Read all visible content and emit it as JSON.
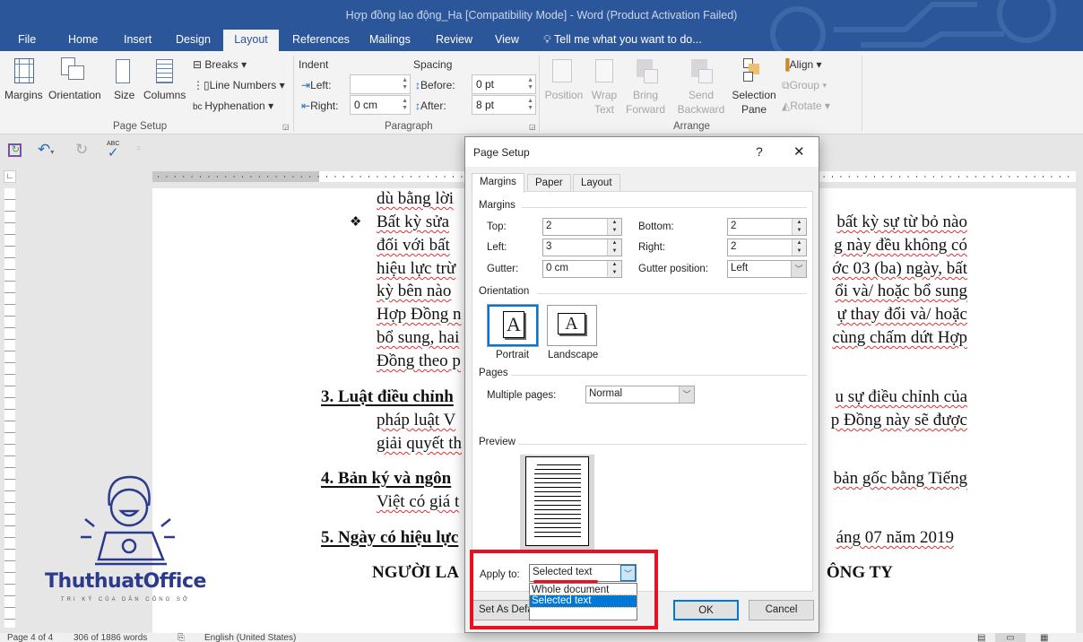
{
  "window": {
    "title": "Hợp đồng lao động_Ha [Compatibility Mode] - Word (Product Activation Failed)"
  },
  "tabs": [
    "File",
    "Home",
    "Insert",
    "Design",
    "Layout",
    "References",
    "Mailings",
    "Review",
    "View"
  ],
  "active_tab": "Layout",
  "tell_me": "Tell me what you want to do...",
  "ribbon": {
    "page_setup": {
      "label": "Page Setup",
      "margins": "Margins",
      "orientation": "Orientation",
      "size": "Size",
      "columns": "Columns",
      "breaks": "Breaks",
      "line_numbers": "Line Numbers",
      "hyphenation": "Hyphenation"
    },
    "paragraph": {
      "label": "Paragraph",
      "indent": "Indent",
      "spacing": "Spacing",
      "left": "Left:",
      "left_value": "",
      "right": "Right:",
      "right_value": "0 cm",
      "before": "Before:",
      "before_value": "0 pt",
      "after": "After:",
      "after_value": "8 pt"
    },
    "arrange": {
      "label": "Arrange",
      "position": "Position",
      "wrap_text_1": "Wrap",
      "wrap_text_2": "Text",
      "bring_forward_1": "Bring",
      "bring_forward_2": "Forward",
      "send_backward_1": "Send",
      "send_backward_2": "Backward",
      "selection_pane_1": "Selection",
      "selection_pane_2": "Pane",
      "align": "Align",
      "group": "Group",
      "rotate": "Rotate"
    }
  },
  "document": {
    "lines": [
      {
        "left": "dù bằng lời",
        "right": ""
      },
      {
        "left": "Bất kỳ sửa",
        "right": "bất kỳ sự từ bỏ nào"
      },
      {
        "left": "đối với bất",
        "right": "g này đều không có"
      },
      {
        "left": "hiệu lực trừ",
        "right": "ớc 03 (ba) ngày, bất"
      },
      {
        "left": "kỳ bên nào",
        "right": "ổi và/ hoặc bổ sung"
      },
      {
        "left": "Hợp Đồng n",
        "right": "ự thay đổi và/ hoặc"
      },
      {
        "left": "bổ sung, hai",
        "right": "cùng chấm dứt Hợp"
      },
      {
        "left": "Đồng theo p",
        "right": ""
      },
      {
        "left": "3. Luật điều chỉnh",
        "right": "u sự điều chỉnh của"
      },
      {
        "left": "pháp luật V",
        "right": "p Đồng này sẽ được"
      },
      {
        "left": "giải quyết th",
        "right": ""
      },
      {
        "left": "4. Bản ký và ngôn",
        "right": "bản gốc bằng Tiếng"
      },
      {
        "left": "Việt có giá t",
        "right": ""
      },
      {
        "left": "5. Ngày có hiệu lực",
        "right": "áng  07  năm 2019"
      },
      {
        "left": "NGƯỜI LA",
        "right": "ÔNG TY"
      }
    ],
    "bullet": "❖"
  },
  "logo": {
    "name": "ThuthuatOffice",
    "tagline": "TRI KỶ CỦA DÂN CÔNG SỞ"
  },
  "status": {
    "page": "Page 4 of 4",
    "words": "306 of 1886 words",
    "language": "English (United States)"
  },
  "dialog": {
    "title": "Page Setup",
    "help": "?",
    "close": "✕",
    "tabs": [
      "Margins",
      "Paper",
      "Layout"
    ],
    "margins_section": "Margins",
    "top_label": "Top:",
    "top": "2",
    "bottom_label": "Bottom:",
    "bottom": "2",
    "left_label": "Left:",
    "left": "3",
    "right_label": "Right:",
    "right": "2",
    "gutter_label": "Gutter:",
    "gutter": "0 cm",
    "gutter_position_label": "Gutter position:",
    "gutter_position": "Left",
    "orientation_section": "Orientation",
    "portrait": "Portrait",
    "landscape": "Landscape",
    "orientation_selected": "Portrait",
    "pages_section": "Pages",
    "multiple_pages_label": "Multiple pages:",
    "multiple_pages": "Normal",
    "preview_section": "Preview",
    "apply_to_label": "Apply to:",
    "apply_to": "Selected text",
    "apply_options": [
      "Whole document",
      "Selected text"
    ],
    "set_default": "Set As Default",
    "ok": "OK",
    "cancel": "Cancel"
  },
  "colors": {
    "brand": "#2b579a",
    "highlight_box": "#e81123",
    "selection": "#0078d7"
  }
}
